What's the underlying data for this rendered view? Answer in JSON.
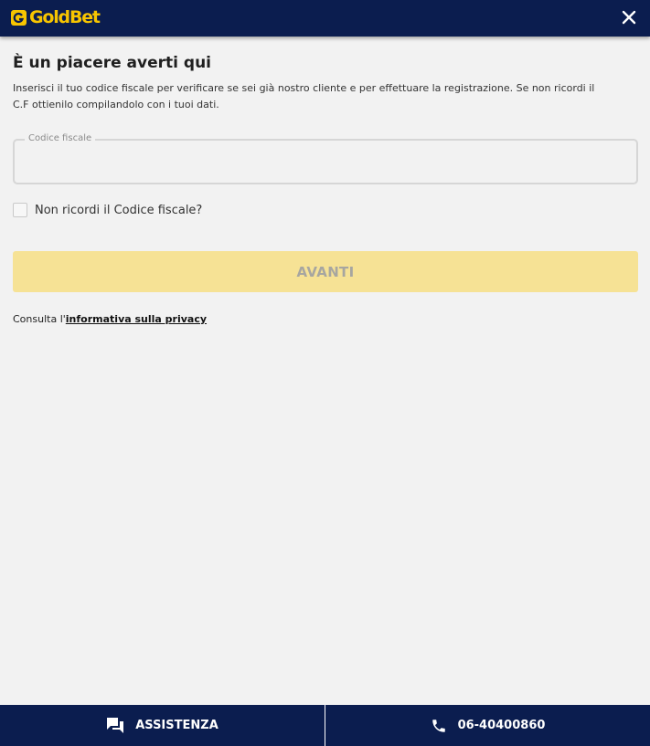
{
  "header": {
    "logo_text": "GoldBet",
    "logo_icon": "goldbet-g-icon",
    "close_icon": "close-icon"
  },
  "main": {
    "title": "È un piacere averti qui",
    "description": "Inserisci il tuo codice fiscale per verificare se sei già nostro cliente e per effettuare la registrazione. Se non ricordi il C.F ottienilo compilandolo con i tuoi dati.",
    "codice_field": {
      "label": "Codice fiscale",
      "value": ""
    },
    "checkbox_label": "Non ricordi il Codice fiscale?",
    "avanti_label": "AVANTI",
    "privacy_prefix": "Consulta l'",
    "privacy_link": "informativa sulla privacy"
  },
  "footer": {
    "assistenza_label": "ASSISTENZA",
    "assistenza_icon": "chat-bubbles-icon",
    "phone_label": "06-40400860",
    "phone_icon": "phone-icon"
  },
  "colors": {
    "brand_navy": "#0b1d4f",
    "brand_gold": "#f7c500",
    "button_disabled_bg": "#f6e295",
    "page_bg": "#f2f2f2"
  }
}
